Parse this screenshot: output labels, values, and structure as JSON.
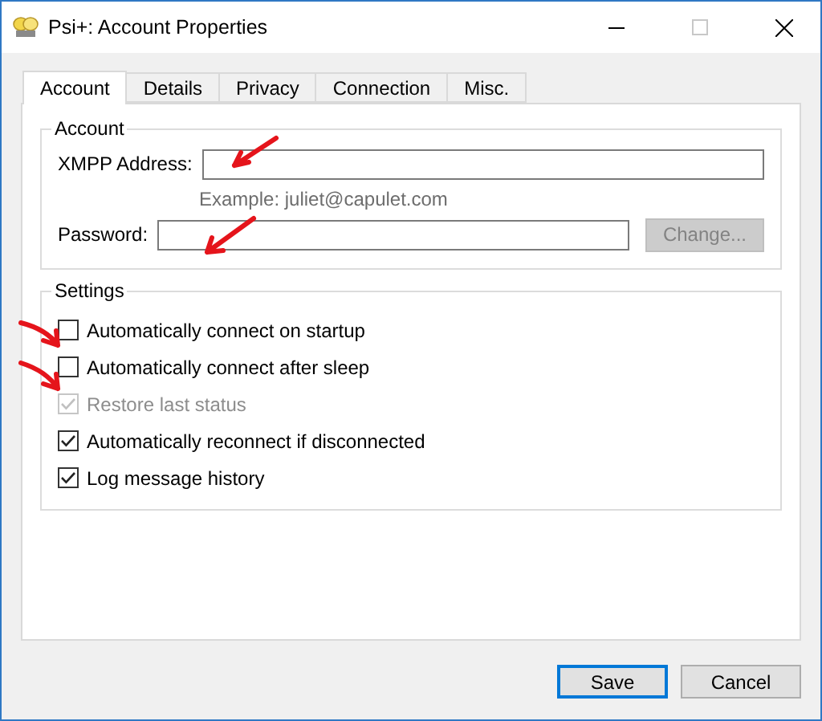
{
  "window": {
    "title": "Psi+: Account Properties"
  },
  "tabs": [
    {
      "label": "Account",
      "selected": true
    },
    {
      "label": "Details",
      "selected": false
    },
    {
      "label": "Privacy",
      "selected": false
    },
    {
      "label": "Connection",
      "selected": false
    },
    {
      "label": "Misc.",
      "selected": false
    }
  ],
  "account": {
    "title": "Account",
    "xmpp_address": {
      "label": "XMPP Address:"
    },
    "example": "Example: juliet@capulet.com",
    "password": {
      "label": "Password:"
    },
    "change_button": {
      "label": "Change...",
      "disabled": true
    }
  },
  "settings": {
    "title": "Settings",
    "options": [
      {
        "label": "Automatically connect on startup",
        "checked": false,
        "disabled": false
      },
      {
        "label": "Automatically connect after sleep",
        "checked": false,
        "disabled": false
      },
      {
        "label": "Restore last status",
        "checked": true,
        "disabled": true
      },
      {
        "label": "Automatically reconnect if disconnected",
        "checked": true,
        "disabled": false
      },
      {
        "label": "Log message history",
        "checked": true,
        "disabled": false
      }
    ]
  },
  "buttons": [
    {
      "label": "Save",
      "default": true
    },
    {
      "label": "Cancel",
      "default": false
    }
  ]
}
